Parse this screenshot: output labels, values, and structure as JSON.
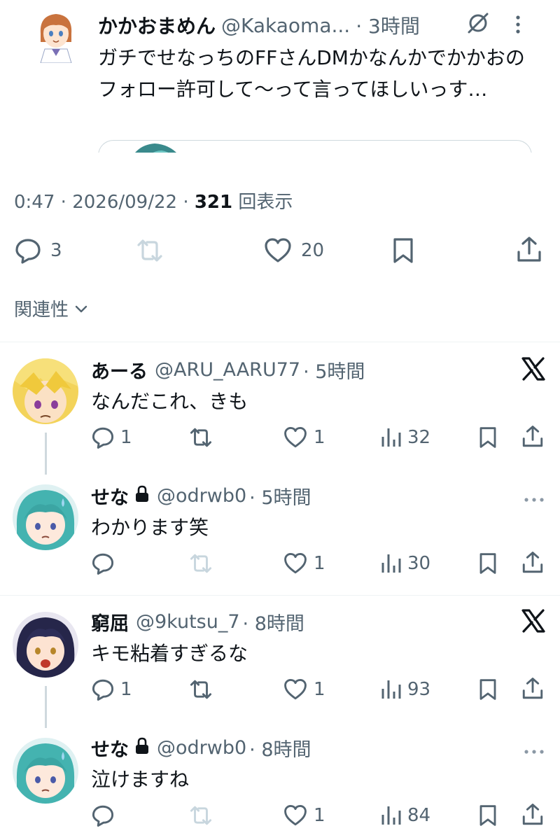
{
  "quoted": {
    "name": "かかおまめん",
    "handle": "@Kakaoma...",
    "time": "· 3時間",
    "text": "ガチでせなっちのFFさんDMかなんかでかかおのフォロー許可して〜って言ってほしいっす…"
  },
  "post": {
    "time": "0:47",
    "date": "2026/09/22",
    "views": "321",
    "views_label": "回表示",
    "reply_count": "3",
    "retweet_count": "",
    "like_count": "20"
  },
  "related": {
    "label": "関連性"
  },
  "replies": [
    {
      "name": "あーる",
      "handle": "@ARU_AARU77",
      "time": "· 5時間",
      "text": "なんだこれ、きも",
      "reply_count": "1",
      "retweet_count": "",
      "like_count": "1",
      "view_count": "32",
      "badge": "x-logo"
    },
    {
      "name": "せな",
      "handle": "@odrwb0",
      "time": "· 5時間",
      "text": "わかります笑",
      "reply_count": "",
      "retweet_count": "",
      "like_count": "1",
      "view_count": "30",
      "badge": "more"
    },
    {
      "name": "窮屈",
      "handle": "@9kutsu_7",
      "time": "· 8時間",
      "text": "キモ粘着すぎるな",
      "reply_count": "1",
      "retweet_count": "",
      "like_count": "1",
      "view_count": "93",
      "badge": "x-logo"
    },
    {
      "name": "せな",
      "handle": "@odrwb0",
      "time": "· 8時間",
      "text": "泣けますね",
      "reply_count": "",
      "retweet_count": "",
      "like_count": "1",
      "view_count": "84",
      "badge": "more"
    }
  ],
  "colors": {
    "text": "#0f1419",
    "secondary": "#536471",
    "divider": "#eff3f4",
    "retweet_disabled": "#c8d6de"
  }
}
